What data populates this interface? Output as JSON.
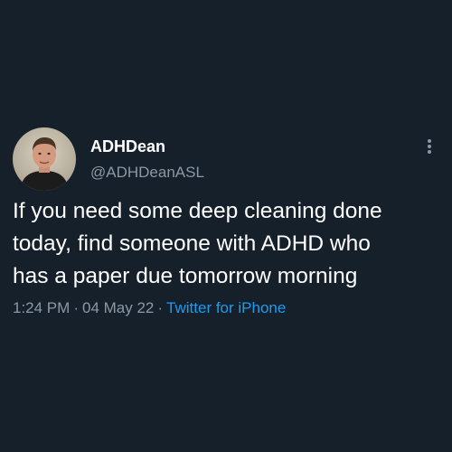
{
  "author": {
    "display_name": "ADHDean",
    "handle": "@ADHDeanASL",
    "avatar_icon": "profile-photo"
  },
  "tweet": {
    "lines": [
      "If you need some deep cleaning done",
      "today, find someone with ADHD who",
      "has a paper due tomorrow morning"
    ]
  },
  "meta": {
    "time": "1:24 PM",
    "separator": "·",
    "date": "04 May 22",
    "source": "Twitter for iPhone"
  },
  "icons": {
    "more": "more-options-icon"
  },
  "colors": {
    "background": "#15202b",
    "primary_text": "#ffffff",
    "secondary_text": "#8b98a5",
    "link": "#1d9bf0"
  }
}
